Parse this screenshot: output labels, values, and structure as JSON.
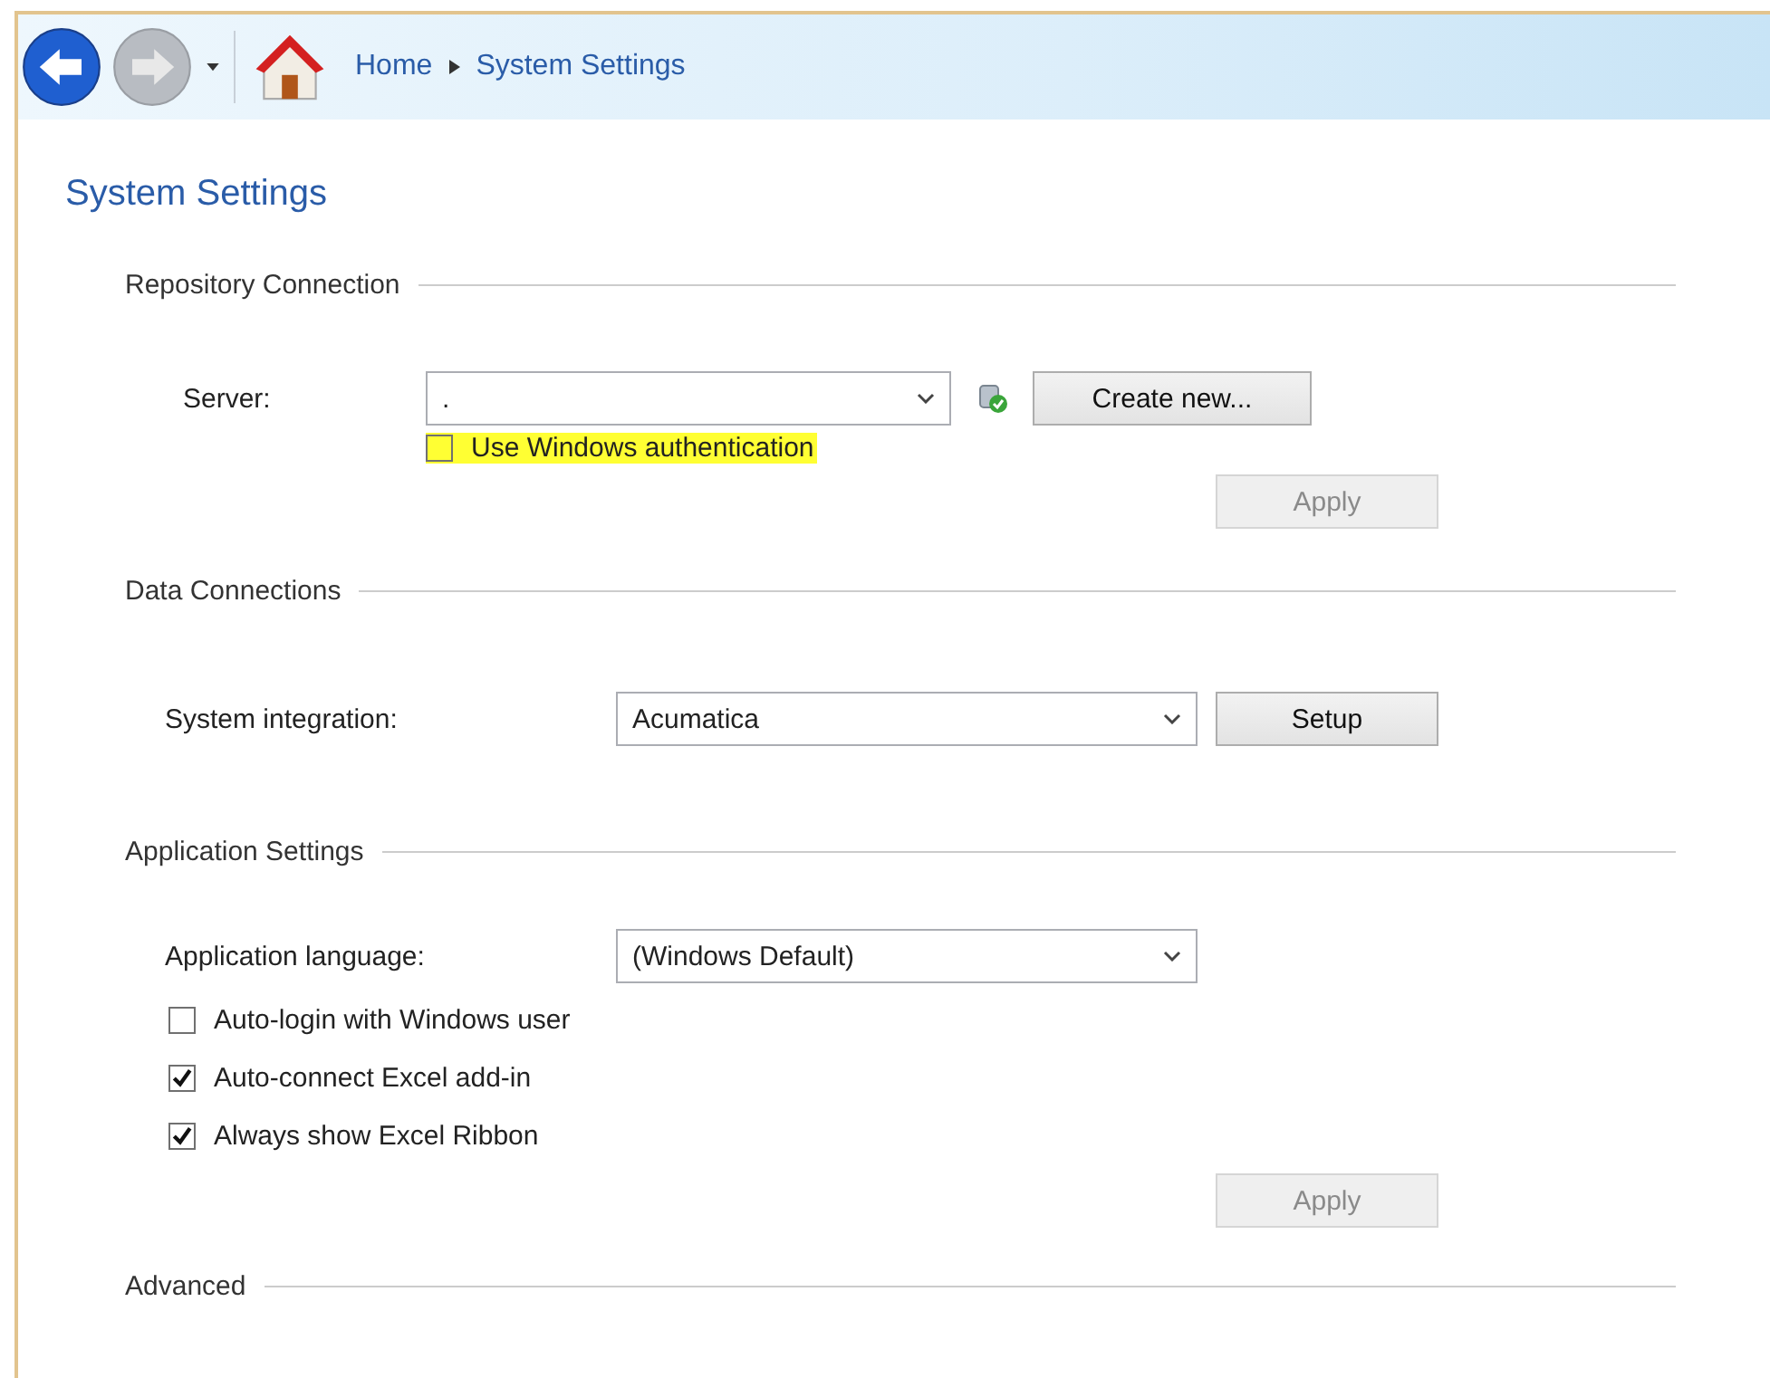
{
  "nav": {
    "back_enabled": true,
    "forward_enabled": false,
    "breadcrumb": [
      "Home",
      "System Settings"
    ]
  },
  "title": "System Settings",
  "repository": {
    "heading": "Repository Connection",
    "server": {
      "label": "Server:",
      "value": "."
    },
    "create_button": "Create new...",
    "windows_auth": {
      "label": "Use Windows authentication",
      "checked": false,
      "highlighted": true
    },
    "apply": {
      "label": "Apply",
      "disabled": true
    }
  },
  "data_connections": {
    "heading": "Data Connections",
    "integration": {
      "label": "System integration:",
      "value": "Acumatica"
    },
    "setup_button": "Setup"
  },
  "application": {
    "heading": "Application Settings",
    "language": {
      "label": "Application language:",
      "value": "(Windows Default)"
    },
    "options": [
      {
        "label": "Auto-login with Windows user",
        "checked": false
      },
      {
        "label": "Auto-connect Excel add-in",
        "checked": true
      },
      {
        "label": "Always show Excel Ribbon",
        "checked": true
      }
    ],
    "apply": {
      "label": "Apply",
      "disabled": true
    }
  },
  "advanced": {
    "heading": "Advanced"
  }
}
